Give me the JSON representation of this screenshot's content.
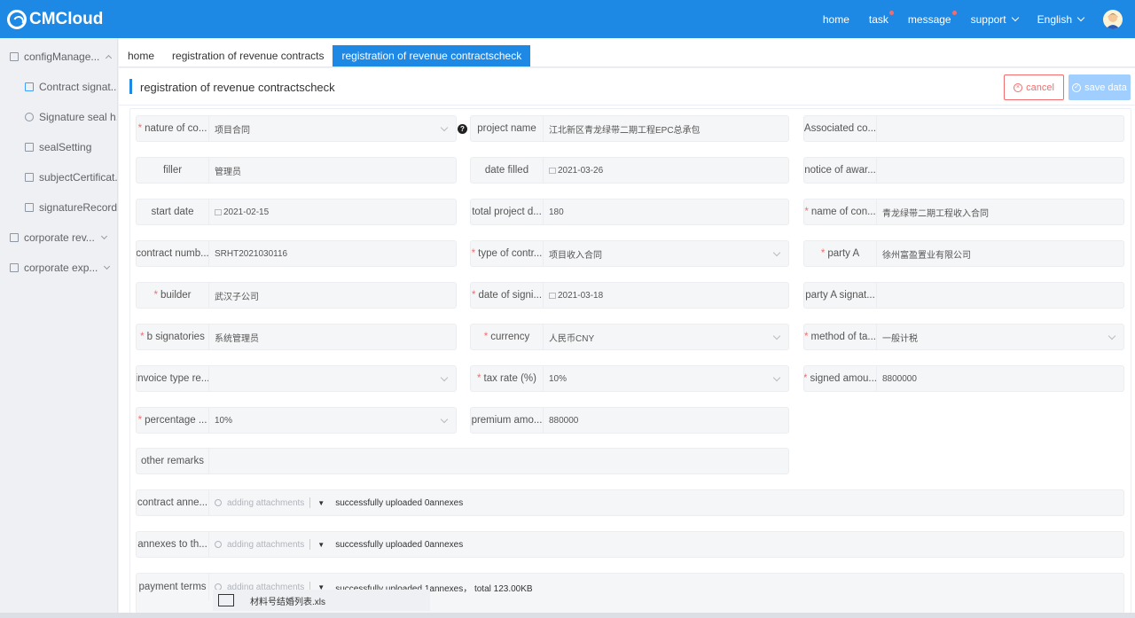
{
  "app": {
    "logo": "CMCloud"
  },
  "topnav": {
    "home": "home",
    "task": "task",
    "message": "message",
    "support": "support",
    "language": "English"
  },
  "sidebar": {
    "items": [
      {
        "label": "configManage...",
        "level": 0,
        "icon": "grid-icon",
        "expanded": true
      },
      {
        "label": "Contract signat...",
        "level": 1,
        "icon": "contract-icon"
      },
      {
        "label": "Signature seal h...",
        "level": 1,
        "icon": "seal-icon"
      },
      {
        "label": "sealSetting",
        "level": 1,
        "icon": "shield-icon"
      },
      {
        "label": "subjectCertificat...",
        "level": 1,
        "icon": "certificate-icon"
      },
      {
        "label": "signatureRecord",
        "level": 1,
        "icon": "record-icon"
      },
      {
        "label": "corporate rev...",
        "level": 0,
        "icon": "document-icon",
        "expanded": false
      },
      {
        "label": "corporate exp...",
        "level": 0,
        "icon": "document-icon",
        "expanded": false
      }
    ]
  },
  "tabs": [
    "home",
    "registration of revenue contracts",
    "registration of revenue contractscheck"
  ],
  "page": {
    "title": "registration of revenue contractscheck",
    "cancel": "cancel",
    "save": "save data"
  },
  "form": {
    "nature": {
      "label": "nature of co...",
      "value": "项目合同"
    },
    "project_name": {
      "label": "project name",
      "value": "江北新区青龙绿带二期工程EPC总承包"
    },
    "associated": {
      "label": "Associated co...",
      "value": ""
    },
    "filler": {
      "label": "filler",
      "value": "管理员"
    },
    "date_filled": {
      "label": "date filled",
      "value": "2021-03-26"
    },
    "notice": {
      "label": "notice of awar...",
      "value": ""
    },
    "start_date": {
      "label": "start date",
      "value": "2021-02-15"
    },
    "total_project": {
      "label": "total project d...",
      "value": "180"
    },
    "name_of_con": {
      "label": "name of con...",
      "value": "青龙绿带二期工程收入合同"
    },
    "contract_number": {
      "label": "contract numb...",
      "value": "SRHT2021030116"
    },
    "type_of_contract": {
      "label": "type of contr...",
      "value": "项目收入合同"
    },
    "party_a": {
      "label": "party A",
      "value": "徐州富盈置业有限公司"
    },
    "builder": {
      "label": "builder",
      "value": "武汉子公司"
    },
    "date_of_signing": {
      "label": "date of signi...",
      "value": "2021-03-18"
    },
    "party_a_signat": {
      "label": "party A signat...",
      "value": ""
    },
    "b_signatories": {
      "label": "b signatories",
      "value": "系统管理员"
    },
    "currency": {
      "label": "currency",
      "value": "人民币CNY"
    },
    "method_of_tax": {
      "label": "method of ta...",
      "value": "一般计税"
    },
    "invoice_type": {
      "label": "invoice type re...",
      "value": ""
    },
    "tax_rate": {
      "label": "tax rate (%)",
      "value": "10%"
    },
    "signed_amount": {
      "label": "signed amou...",
      "value": "8800000"
    },
    "percentage": {
      "label": "percentage ...",
      "value": "10%"
    },
    "premium_amount": {
      "label": "premium amo...",
      "value": "880000"
    },
    "other_remarks": {
      "label": "other remarks",
      "value": ""
    },
    "contract_annexes": {
      "label": "contract anne...",
      "attach": "adding attachments",
      "status": "successfully uploaded 0annexes"
    },
    "annexes_to": {
      "label": "annexes to th...",
      "attach": "adding attachments",
      "status": "successfully uploaded 0annexes"
    },
    "payment_terms": {
      "label": "payment terms",
      "attach": "adding attachments",
      "status": "successfully uploaded 1annexes， total 123.00KB",
      "file": "材料号结婚列表.xls"
    }
  }
}
